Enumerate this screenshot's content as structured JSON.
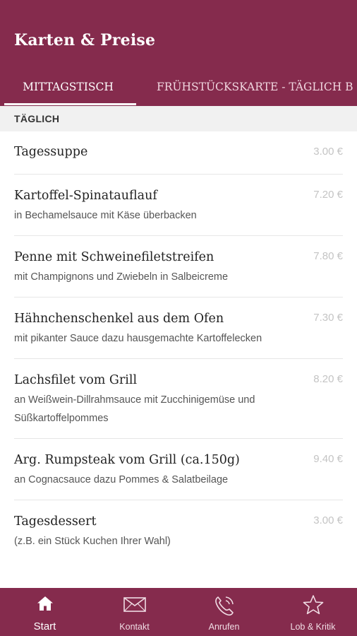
{
  "header": {
    "title": "Karten & Preise"
  },
  "tabs": [
    {
      "label": "MITTAGSTISCH"
    },
    {
      "label": "FRÜHSTÜCKSKARTE - TÄGLICH B"
    }
  ],
  "section": {
    "title": "TÄGLICH"
  },
  "items": [
    {
      "name": "Tagessuppe",
      "price": "3.00 €",
      "desc": ""
    },
    {
      "name": "Kartoffel-Spinatauflauf",
      "price": "7.20 €",
      "desc": "in Bechamelsauce mit Käse überbacken"
    },
    {
      "name": "Penne mit Schweinefiletstreifen",
      "price": "7.80 €",
      "desc": "mit Champignons und Zwiebeln in Salbeicreme"
    },
    {
      "name": "Hähnchenschenkel aus dem Ofen",
      "price": "7.30 €",
      "desc": "mit pikanter Sauce dazu hausgemachte Kartoffelecken"
    },
    {
      "name": "Lachsfilet vom Grill",
      "price": "8.20 €",
      "desc": "an Weißwein-Dillrahmsauce mit Zucchinigemüse und Süßkartoffelpommes"
    },
    {
      "name": "Arg. Rumpsteak vom Grill (ca.150g)",
      "price": "9.40 €",
      "desc": "an Cognacsauce dazu Pommes & Salatbeilage"
    },
    {
      "name": "Tagesdessert",
      "price": "3.00 €",
      "desc": "(z.B. ein Stück Kuchen Ihrer Wahl)"
    }
  ],
  "bottom_nav": [
    {
      "label": "Start",
      "icon": "home-icon",
      "active": true
    },
    {
      "label": "Kontakt",
      "icon": "envelope-icon"
    },
    {
      "label": "Anrufen",
      "icon": "phone-icon"
    },
    {
      "label": "Lob & Kritik",
      "icon": "star-icon"
    }
  ],
  "colors": {
    "primary": "#852b4d",
    "section_bg": "#f1f1f1",
    "price": "#c4c4c4"
  }
}
